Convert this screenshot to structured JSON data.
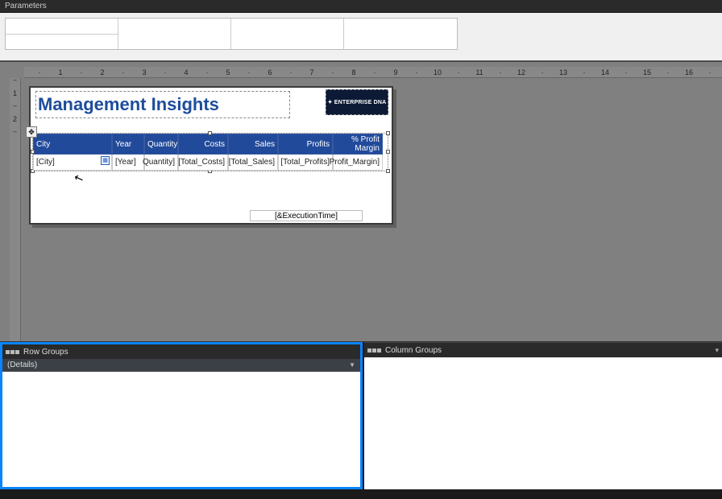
{
  "parameters": {
    "header": "Parameters"
  },
  "ruler_h": [
    "·",
    "1",
    "·",
    "2",
    "·",
    "3",
    "·",
    "4",
    "·",
    "5",
    "·",
    "6",
    "·",
    "7",
    "·",
    "8",
    "·",
    "9",
    "·",
    "10",
    "·",
    "11",
    "·",
    "12",
    "·",
    "13",
    "·",
    "14",
    "·",
    "15",
    "·",
    "16",
    "·"
  ],
  "ruler_v": [
    "–",
    "1",
    "–",
    "2",
    "–"
  ],
  "report": {
    "title": "Management Insights",
    "logo_text": "✦ ENTERPRISE DNA",
    "exec_time": "[&ExecutionTime]"
  },
  "tablix": {
    "headers": [
      "City",
      "Year",
      "Quantity",
      "Costs",
      "Sales",
      "Profits",
      "% Profit Margin"
    ],
    "detail": [
      "[City]",
      "[Year]",
      "Quantity]",
      "[Total_Costs]",
      "[Total_Sales]",
      "[Total_Profits]",
      "Profit_Margin]"
    ],
    "move_handle": "✥"
  },
  "groups": {
    "row_header": "Row Groups",
    "col_header": "Column Groups",
    "row_items": [
      "(Details)"
    ]
  }
}
